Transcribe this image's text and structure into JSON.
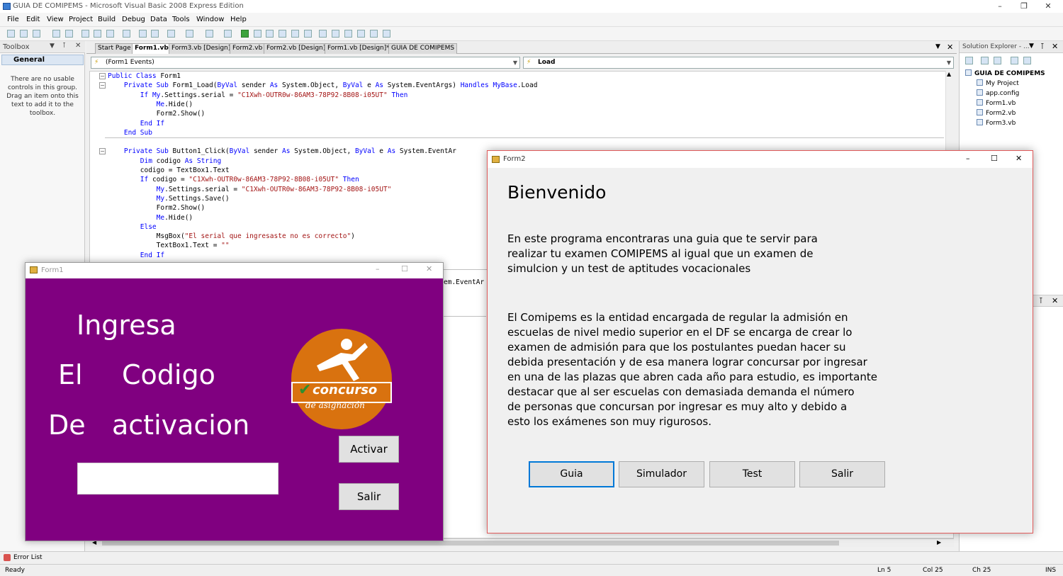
{
  "ide": {
    "title": "GUIA DE COMIPEMS - Microsoft Visual Basic 2008 Express Edition",
    "menu": [
      "File",
      "Edit",
      "View",
      "Project",
      "Build",
      "Debug",
      "Data",
      "Tools",
      "Window",
      "Help"
    ],
    "toolbox": {
      "title": "Toolbox",
      "group": "General",
      "empty_message": "There are no usable controls in this group. Drag an item onto this text to add it to the toolbox."
    },
    "tabs": [
      "Start Page",
      "Form1.vb*",
      "Form3.vb [Design]",
      "Form2.vb",
      "Form2.vb [Design]",
      "Form1.vb [Design]*",
      "GUIA DE COMIPEMS"
    ],
    "object_combo": "(Form1 Events)",
    "event_combo": "Load",
    "code": [
      {
        "parts": [
          [
            "kw",
            "Public Class"
          ],
          [
            "",
            " Form1"
          ]
        ]
      },
      {
        "parts": [
          [
            "",
            "    "
          ],
          [
            "kw",
            "Private Sub"
          ],
          [
            "",
            " Form1_Load("
          ],
          [
            "kw",
            "ByVal"
          ],
          [
            "",
            " sender "
          ],
          [
            "kw",
            "As"
          ],
          [
            "",
            " System.Object, "
          ],
          [
            "kw",
            "ByVal"
          ],
          [
            "",
            " e "
          ],
          [
            "kw",
            "As"
          ],
          [
            "",
            " System.EventArgs) "
          ],
          [
            "kw",
            "Handles"
          ],
          [
            "",
            " "
          ],
          [
            "kw",
            "MyBase"
          ],
          [
            "",
            ".Load"
          ]
        ]
      },
      {
        "parts": [
          [
            "",
            "        "
          ],
          [
            "kw",
            "If"
          ],
          [
            "",
            " "
          ],
          [
            "kw",
            "My"
          ],
          [
            "",
            ".Settings.serial = "
          ],
          [
            "str",
            "\"C1Xwh-OUTR0w-86AM3-78P92-8B08-i05UT\""
          ],
          [
            "",
            " "
          ],
          [
            "kw",
            "Then"
          ]
        ]
      },
      {
        "parts": [
          [
            "",
            "            "
          ],
          [
            "kw",
            "Me"
          ],
          [
            "",
            ".Hide()"
          ]
        ]
      },
      {
        "parts": [
          [
            "",
            "            Form2.Show()"
          ]
        ]
      },
      {
        "parts": [
          [
            "",
            "        "
          ],
          [
            "kw",
            "End If"
          ]
        ]
      },
      {
        "parts": [
          [
            "",
            "    "
          ],
          [
            "kw",
            "End Sub"
          ]
        ]
      },
      {
        "parts": [
          [
            "",
            ""
          ]
        ]
      },
      {
        "parts": [
          [
            "",
            "    "
          ],
          [
            "kw",
            "Private Sub"
          ],
          [
            "",
            " Button1_Click("
          ],
          [
            "kw",
            "ByVal"
          ],
          [
            "",
            " sender "
          ],
          [
            "kw",
            "As"
          ],
          [
            "",
            " System.Object, "
          ],
          [
            "kw",
            "ByVal"
          ],
          [
            "",
            " e "
          ],
          [
            "kw",
            "As"
          ],
          [
            "",
            " System.EventAr"
          ]
        ]
      },
      {
        "parts": [
          [
            "",
            "        "
          ],
          [
            "kw",
            "Dim"
          ],
          [
            "",
            " codigo "
          ],
          [
            "kw",
            "As String"
          ]
        ]
      },
      {
        "parts": [
          [
            "",
            "        codigo = TextBox1.Text"
          ]
        ]
      },
      {
        "parts": [
          [
            "",
            "        "
          ],
          [
            "kw",
            "If"
          ],
          [
            "",
            " codigo = "
          ],
          [
            "str",
            "\"C1Xwh-OUTR0w-86AM3-78P92-8B08-i05UT\""
          ],
          [
            "",
            " "
          ],
          [
            "kw",
            "Then"
          ]
        ]
      },
      {
        "parts": [
          [
            "",
            "            "
          ],
          [
            "kw",
            "My"
          ],
          [
            "",
            ".Settings.serial = "
          ],
          [
            "str",
            "\"C1Xwh-OUTR0w-86AM3-78P92-8B08-i05UT\""
          ]
        ]
      },
      {
        "parts": [
          [
            "",
            "            "
          ],
          [
            "kw",
            "My"
          ],
          [
            "",
            ".Settings.Save()"
          ]
        ]
      },
      {
        "parts": [
          [
            "",
            "            Form2.Show()"
          ]
        ]
      },
      {
        "parts": [
          [
            "",
            "            "
          ],
          [
            "kw",
            "Me"
          ],
          [
            "",
            ".Hide()"
          ]
        ]
      },
      {
        "parts": [
          [
            "",
            "        "
          ],
          [
            "kw",
            "Else"
          ]
        ]
      },
      {
        "parts": [
          [
            "",
            "            MsgBox("
          ],
          [
            "str",
            "\"El serial que ingresaste no es correcto\""
          ],
          [
            "",
            ")"
          ]
        ]
      },
      {
        "parts": [
          [
            "",
            "            TextBox1.Text = "
          ],
          [
            "str",
            "\"\""
          ]
        ]
      },
      {
        "parts": [
          [
            "",
            "        "
          ],
          [
            "kw",
            "End If"
          ]
        ]
      }
    ],
    "hidden_code_tail": "em.EventAr",
    "solution_explorer": {
      "title": "Solution Explorer - ...",
      "root": "GUIA DE COMIPEMS",
      "items": [
        "My Project",
        "app.config",
        "Form1.vb",
        "Form2.vb",
        "Form3.vb"
      ]
    },
    "error_list": "Error List",
    "status": {
      "state": "Ready",
      "ln": "Ln 5",
      "col": "Col 25",
      "ch": "Ch 25",
      "mode": "INS"
    }
  },
  "form1": {
    "title": "Form1",
    "lines": [
      "Ingresa",
      "El",
      "Codigo",
      "De",
      "activacion"
    ],
    "activate_button": "Activar",
    "exit_button": "Salir",
    "input_value": "",
    "logo": {
      "word1": "concurso",
      "word2": "de asignación"
    },
    "bg_color": "#800080"
  },
  "form2": {
    "title": "Form2",
    "heading": "Bienvenido",
    "paragraph1": [
      "En este programa encontraras una guia que te servir para",
      "realizar tu examen COMIPEMS al igual que un examen de",
      "simulcion y un test de aptitudes vocacionales"
    ],
    "paragraph2": [
      "El Comipems es la entidad encargada de regular la admisión en",
      "escuelas de nivel medio superior en el DF se encarga de crear lo",
      "examen de admisión para que los postulantes puedan hacer su",
      "debida presentación y de esa manera lograr concursar por ingresar",
      "en una de las plazas que abren cada año para estudio, es importante",
      "destacar que al ser escuelas con demasiada demanda el número",
      "de personas que concursan por ingresar es muy alto y debido a",
      "esto los exámenes son muy rigurosos."
    ],
    "buttons": [
      "Guia",
      "Simulador",
      "Test",
      "Salir"
    ]
  }
}
